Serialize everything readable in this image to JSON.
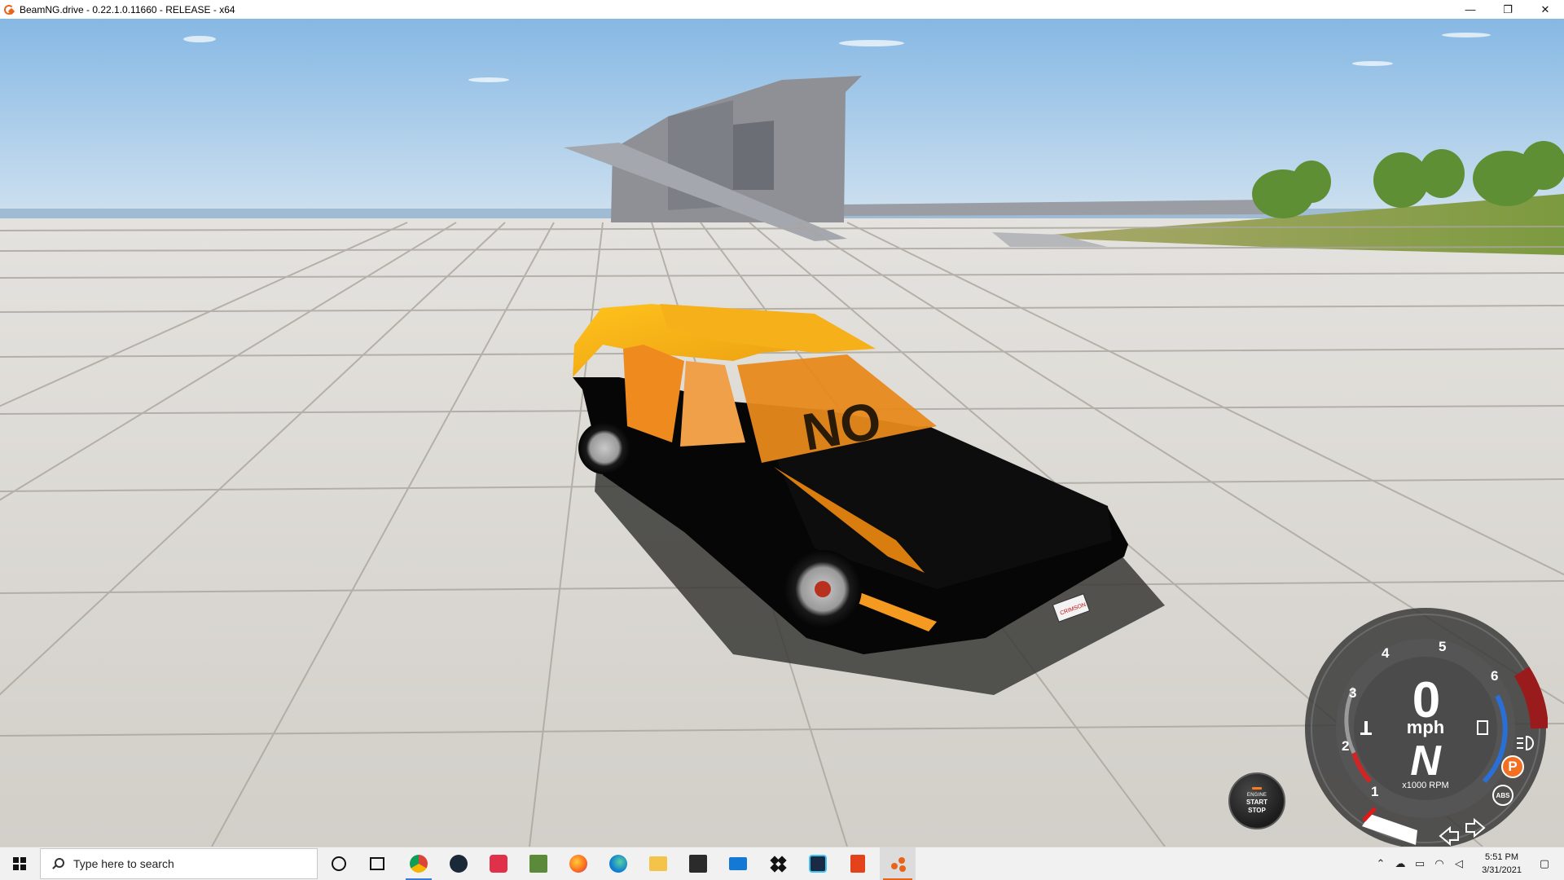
{
  "window": {
    "title": "BeamNG.drive - 0.22.1.0.11660 - RELEASE - x64",
    "controls": {
      "minimize": "—",
      "restore": "❐",
      "close": "✕"
    }
  },
  "hud": {
    "engine_button": {
      "line1": "ENGINE",
      "line2": "START",
      "line3": "STOP"
    },
    "gauge": {
      "speed": "0",
      "speed_unit": "mph",
      "gear": "N",
      "rpm_unit": "x1000 RPM",
      "rpm_marks": [
        "1",
        "2",
        "3",
        "4",
        "5",
        "6"
      ],
      "parking_brake": "P",
      "abs": "ABS"
    }
  },
  "vehicle": {
    "plate_text": "CRIMSON",
    "roof_lettering": "NO",
    "body_color": "#0a0a0a",
    "roof_color": "#f7b718"
  },
  "taskbar": {
    "search_placeholder": "Type here to search",
    "pinned_apps": [
      "cortana-icon",
      "task-view-icon",
      "chrome-icon",
      "steam-icon",
      "game-app-icon",
      "minecraft-icon",
      "firefox-icon",
      "edge-icon",
      "file-explorer-icon",
      "store-icon",
      "mail-icon",
      "dropbox-icon",
      "unity-icon",
      "office-icon",
      "beamng-icon"
    ],
    "clock": {
      "time": "5:51 PM",
      "date": "3/31/2021"
    }
  },
  "colors": {
    "accent": "#e8641b",
    "sky_top": "#86b8e4",
    "floor": "#d9d6d0"
  }
}
